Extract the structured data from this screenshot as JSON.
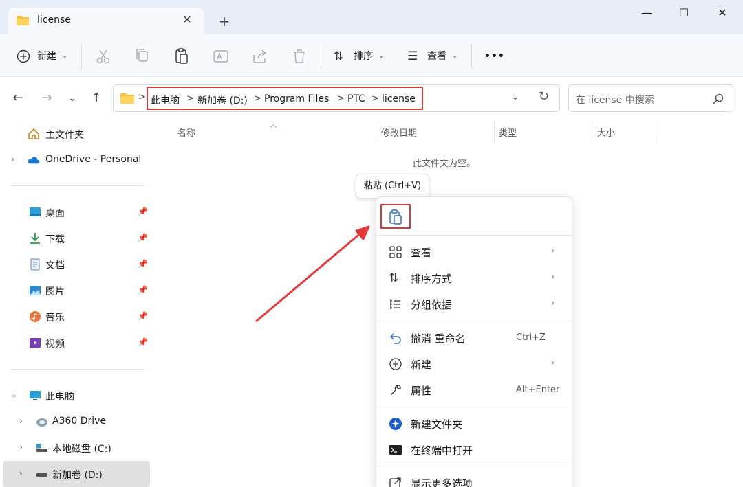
{
  "tab": {
    "title": "license",
    "close": "✕",
    "new": "+"
  },
  "window": {
    "minimize": "—",
    "maximize": "☐",
    "close": "✕"
  },
  "commandbar": {
    "new_label": "新建",
    "sort_label": "排序",
    "view_label": "查看",
    "more": "•••"
  },
  "address": {
    "crumbs": [
      "此电脑",
      "新加卷 (D:)",
      "Program Files",
      "PTC",
      "license"
    ],
    "separator": ">"
  },
  "search": {
    "placeholder": "在 license 中搜索"
  },
  "sidebar": {
    "home": "主文件夹",
    "onedrive": "OneDrive - Personal",
    "quick": [
      {
        "label": "桌面",
        "icon": "desktop-icon"
      },
      {
        "label": "下载",
        "icon": "download-icon"
      },
      {
        "label": "文档",
        "icon": "document-icon"
      },
      {
        "label": "图片",
        "icon": "pictures-icon"
      },
      {
        "label": "音乐",
        "icon": "music-icon"
      },
      {
        "label": "视频",
        "icon": "video-icon"
      }
    ],
    "this_pc": "此电脑",
    "drives": [
      "A360 Drive",
      "本地磁盘 (C:)",
      "新加卷 (D:)"
    ]
  },
  "columns": {
    "name": "名称",
    "modified": "修改日期",
    "type": "类型",
    "size": "大小"
  },
  "empty_message": "此文件夹为空。",
  "tooltip": "粘贴 (Ctrl+V)",
  "context_menu": {
    "view": "查看",
    "sort": "排序方式",
    "group": "分组依据",
    "undo": "撤消 重命名",
    "undo_shortcut": "Ctrl+Z",
    "new": "新建",
    "properties": "属性",
    "properties_shortcut": "Alt+Enter",
    "new_folder": "新建文件夹",
    "open_terminal": "在终端中打开",
    "more_options": "显示更多选项"
  },
  "colors": {
    "accent": "#0067c0",
    "highlight": "#d83b3b",
    "folder": "#f6c141"
  }
}
